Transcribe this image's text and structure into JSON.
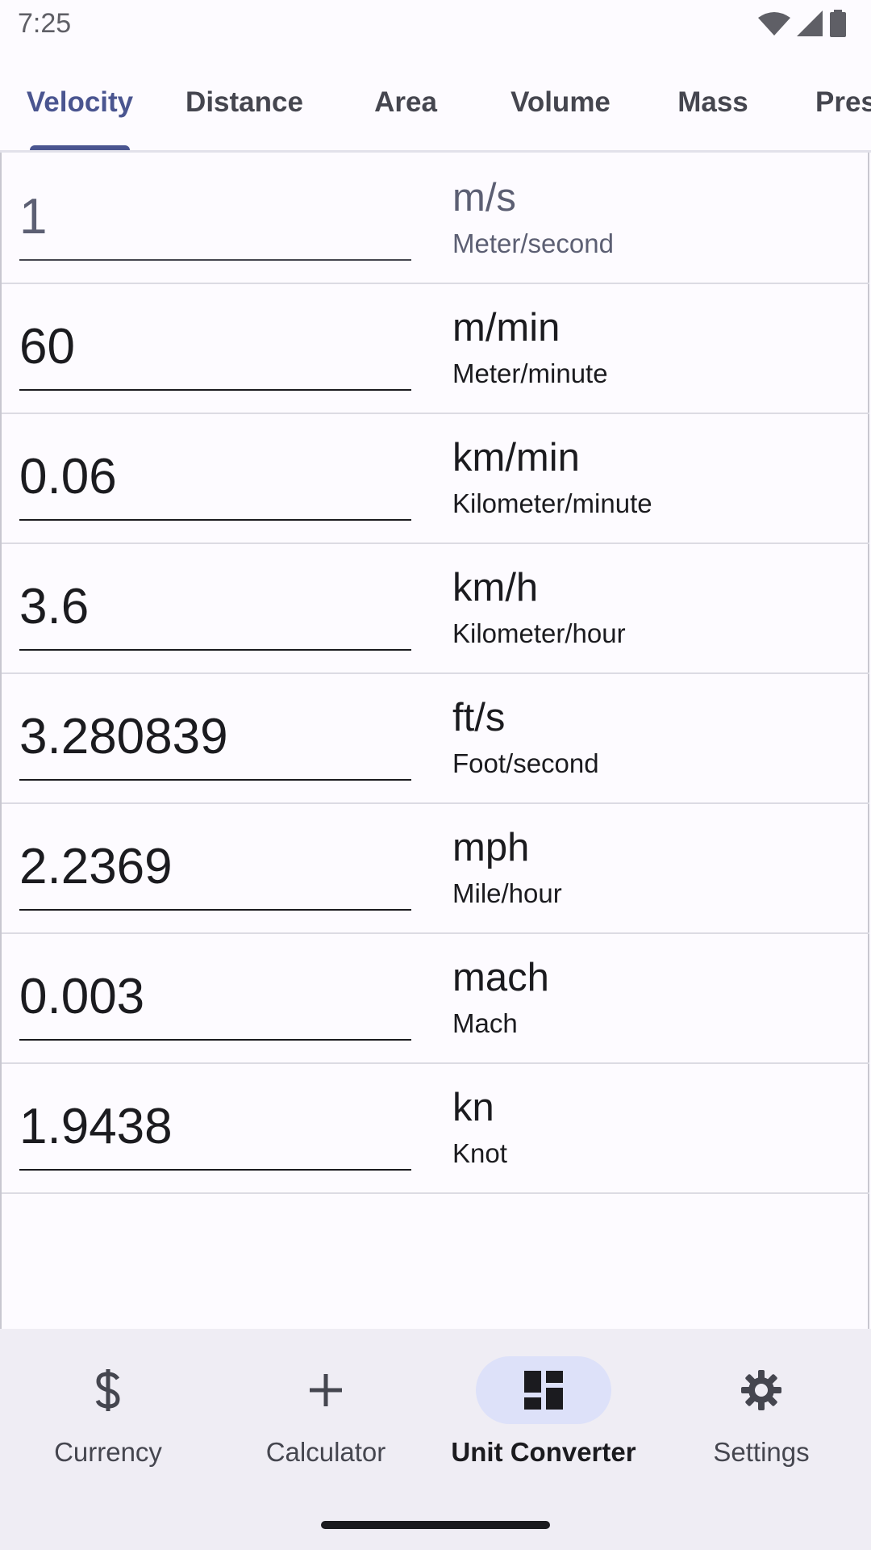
{
  "status_bar": {
    "time": "7:25",
    "icons": [
      "wifi-icon",
      "cellular-signal-icon",
      "battery-icon"
    ]
  },
  "tabs": [
    {
      "label": "Velocity",
      "active": true
    },
    {
      "label": "Distance",
      "active": false
    },
    {
      "label": "Area",
      "active": false
    },
    {
      "label": "Volume",
      "active": false
    },
    {
      "label": "Mass",
      "active": false
    },
    {
      "label": "Pressure",
      "active": false
    }
  ],
  "conversions": [
    {
      "value": "1",
      "unit": "m/s",
      "unit_name": "Meter/second"
    },
    {
      "value": "60",
      "unit": "m/min",
      "unit_name": "Meter/minute"
    },
    {
      "value": "0.06",
      "unit": "km/min",
      "unit_name": "Kilometer/minute"
    },
    {
      "value": "3.6",
      "unit": "km/h",
      "unit_name": "Kilometer/hour"
    },
    {
      "value": "3.280839",
      "unit": "ft/s",
      "unit_name": "Foot/second"
    },
    {
      "value": "2.2369",
      "unit": "mph",
      "unit_name": "Mile/hour"
    },
    {
      "value": "0.003",
      "unit": "mach",
      "unit_name": "Mach"
    },
    {
      "value": "1.9438",
      "unit": "kn",
      "unit_name": "Knot"
    }
  ],
  "bottom_nav": [
    {
      "label": "Currency",
      "icon": "dollar-icon",
      "active": false
    },
    {
      "label": "Calculator",
      "icon": "plus-icon",
      "active": false
    },
    {
      "label": "Unit Converter",
      "icon": "dashboard-icon",
      "active": true
    },
    {
      "label": "Settings",
      "icon": "gear-icon",
      "active": false
    }
  ],
  "colors": {
    "accent": "#4a5590",
    "active_pill": "#dde1f9",
    "nav_background": "#efedf4",
    "background": "#fdfbff"
  }
}
